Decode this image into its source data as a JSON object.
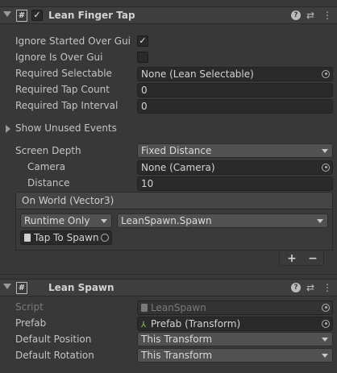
{
  "lean_finger_tap": {
    "title": "Lean Finger Tap",
    "enabled_glyph": "✓",
    "fields": {
      "ignore_started_over_gui": {
        "label": "Ignore Started Over Gui",
        "checked": true
      },
      "ignore_is_over_gui": {
        "label": "Ignore Is Over Gui",
        "checked": false
      },
      "required_selectable": {
        "label": "Required Selectable",
        "value": "None (Lean Selectable)"
      },
      "required_tap_count": {
        "label": "Required Tap Count",
        "value": "0"
      },
      "required_tap_interval": {
        "label": "Required Tap Interval",
        "value": "0"
      }
    },
    "show_unused_events": "Show Unused Events",
    "screen_depth": {
      "label": "Screen Depth",
      "value": "Fixed Distance",
      "camera": {
        "label": "Camera",
        "value": "None (Camera)"
      },
      "distance": {
        "label": "Distance",
        "value": "10"
      }
    },
    "on_world": {
      "header": "On World (Vector3)",
      "runtime": "Runtime Only",
      "function": "LeanSpawn.Spawn",
      "target": "Tap To Spawn",
      "add": "+",
      "remove": "−"
    }
  },
  "lean_spawn": {
    "title": "Lean Spawn",
    "fields": {
      "script": {
        "label": "Script",
        "value": "LeanSpawn"
      },
      "prefab": {
        "label": "Prefab",
        "value": "Prefab (Transform)"
      },
      "default_position": {
        "label": "Default Position",
        "value": "This Transform"
      },
      "default_rotation": {
        "label": "Default Rotation",
        "value": "This Transform"
      }
    }
  },
  "icons": {
    "help": "?",
    "settings": "⇄",
    "more": "⋮",
    "script": "#"
  },
  "colors": {
    "background": "#383838",
    "header": "#3e3e3e",
    "field": "#2a2a2a",
    "dropdown": "#515151"
  }
}
